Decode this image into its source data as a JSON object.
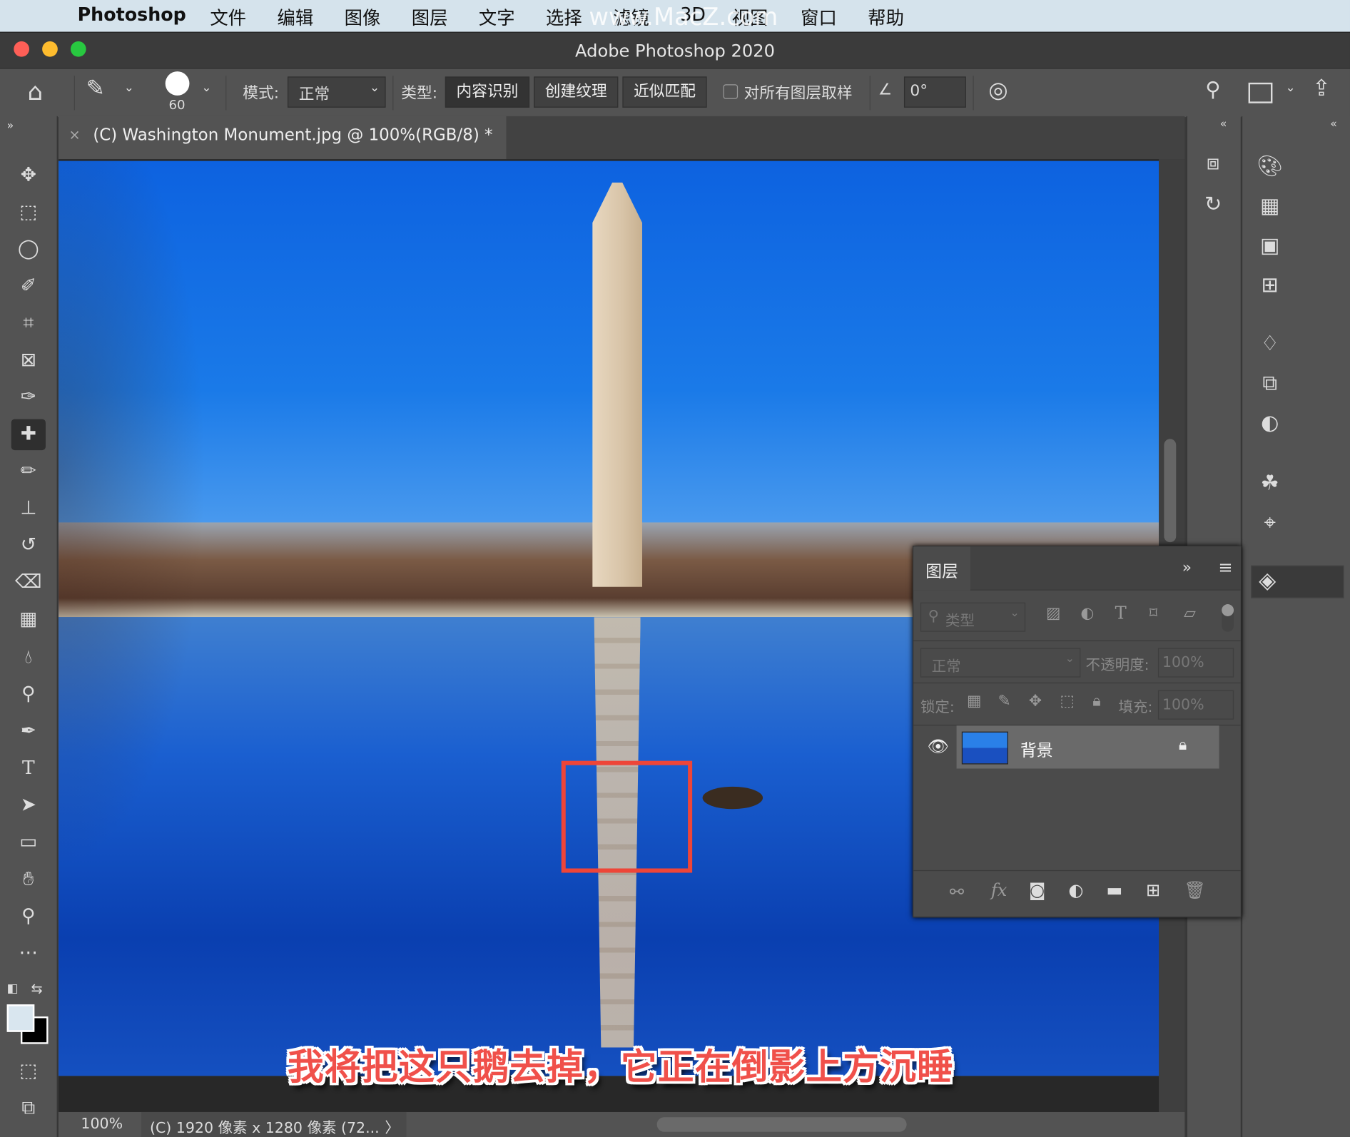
{
  "menubar": {
    "app": "Photoshop",
    "items": [
      "文件",
      "编辑",
      "图像",
      "图层",
      "文字",
      "选择",
      "滤镜",
      "3D",
      "视图",
      "窗口",
      "帮助"
    ],
    "watermark": "www.MacZ.com"
  },
  "window": {
    "title": "Adobe Photoshop 2020"
  },
  "options": {
    "brush_size": "60",
    "mode_label": "模式:",
    "mode_value": "正常",
    "type_label": "类型:",
    "type_buttons": [
      "内容识别",
      "创建纹理",
      "近似匹配"
    ],
    "sample_all_label": "对所有图层取样",
    "sample_all_checked": false,
    "angle_value": "0°"
  },
  "document": {
    "tab_title": "(C) Washington Monument.jpg @ 100%(RGB/8) *",
    "close": "×"
  },
  "caption": "我将把这只鹅去掉，它正在倒影上方沉睡",
  "status": {
    "zoom": "100%",
    "info": "(C) 1920 像素 x 1280 像素 (72...",
    "arrow": "〉"
  },
  "layers_panel": {
    "tab": "图层",
    "filter_placeholder": "类型",
    "blend_mode": "正常",
    "opacity_label": "不透明度:",
    "opacity_value": "100%",
    "lock_label": "锁定:",
    "fill_label": "填充:",
    "fill_value": "100%",
    "layers": [
      {
        "name": "背景",
        "visible": true,
        "locked": true
      }
    ]
  },
  "colors": {
    "accent_red": "#f0504a",
    "foreground": "#d9e6ef",
    "background": "#000000"
  }
}
